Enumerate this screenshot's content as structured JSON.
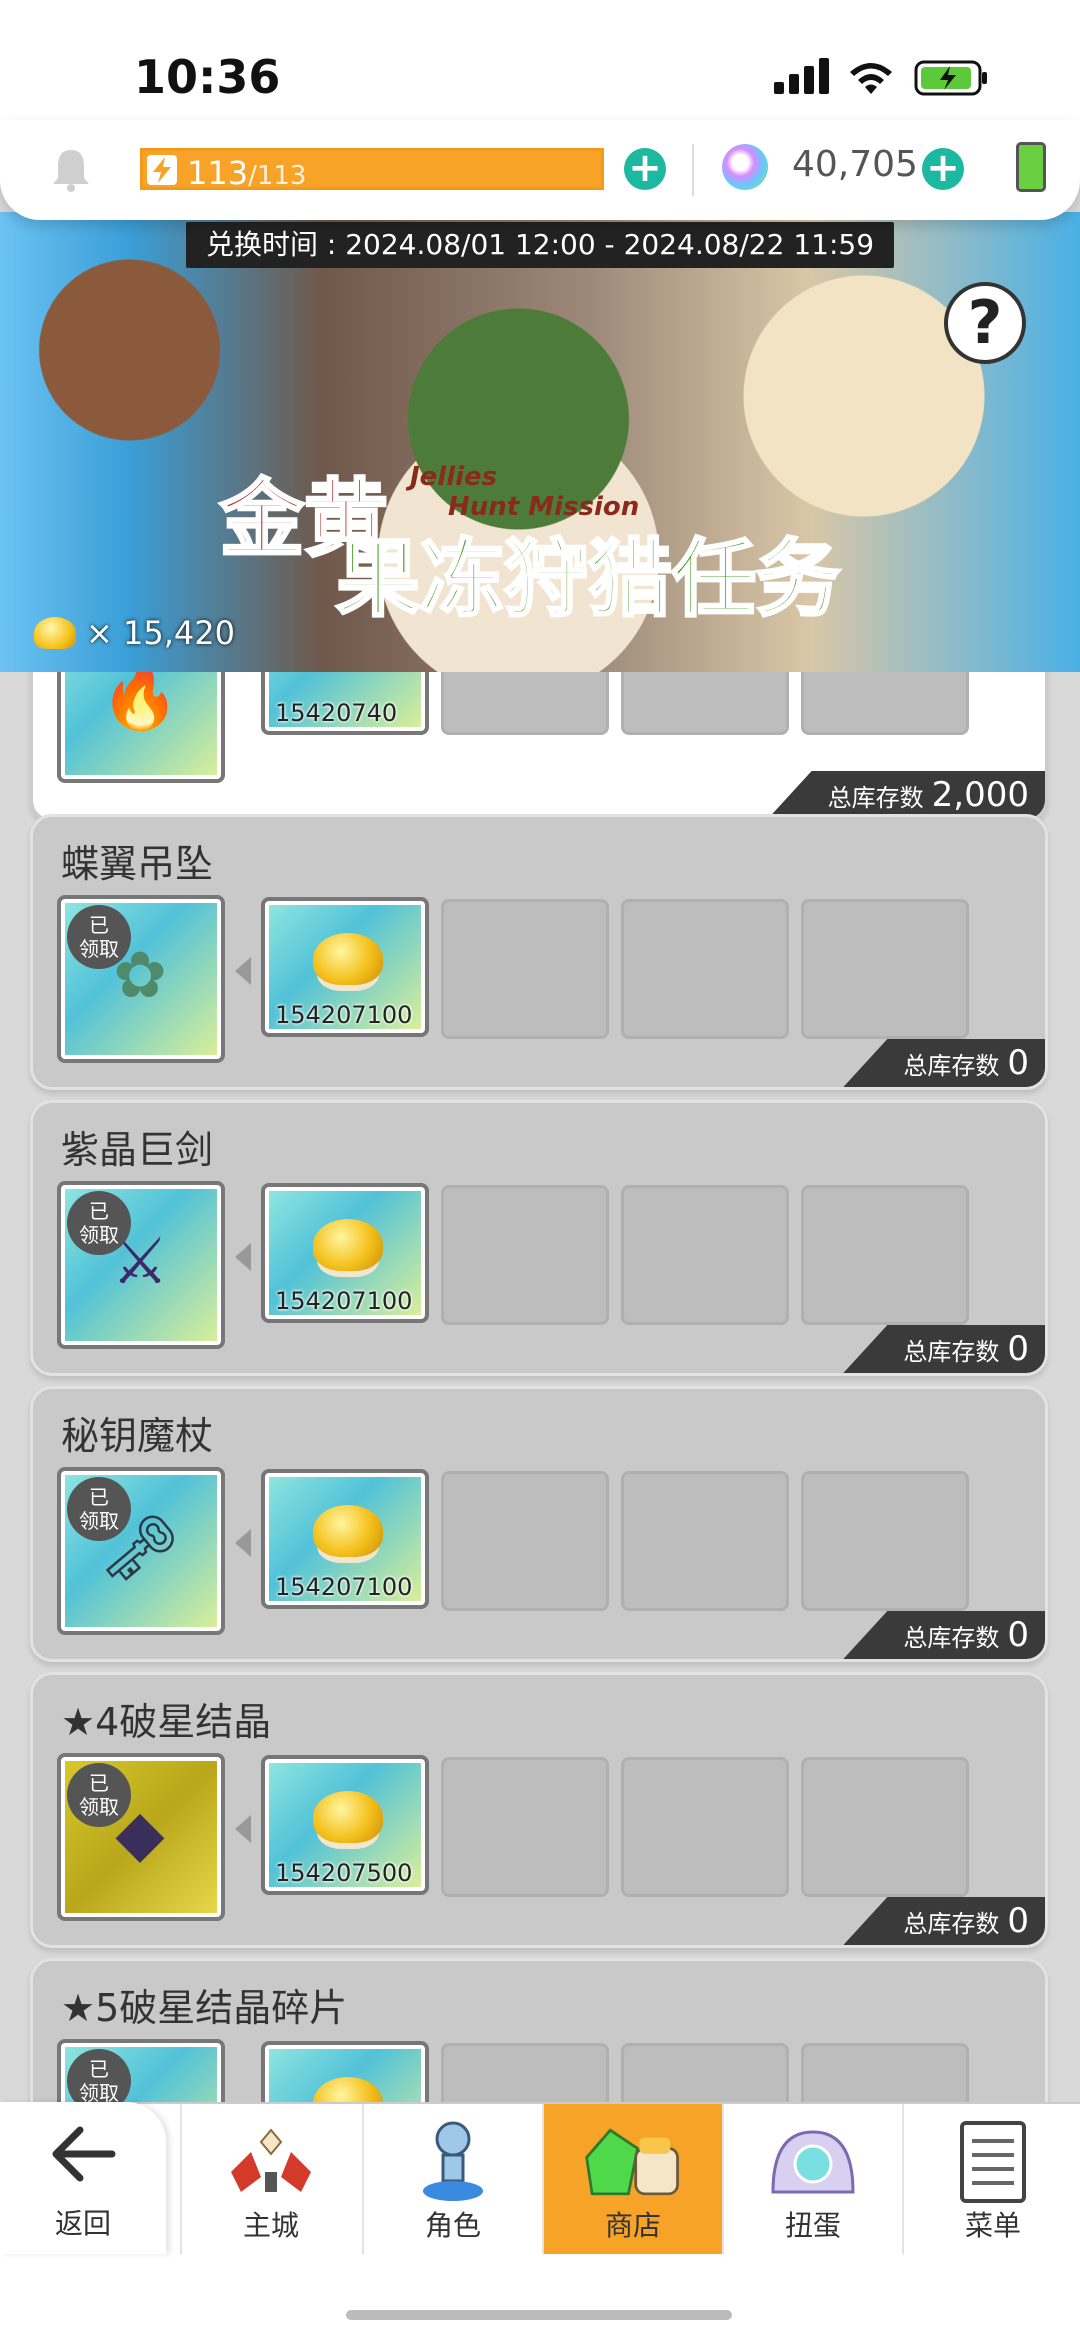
{
  "status_bar": {
    "time": "10:36"
  },
  "resources": {
    "energy_current": "113",
    "energy_max": "/113",
    "gems": "40,705"
  },
  "banner": {
    "exchange_time": "兑换时间 : 2024.08/01 12:00 - 2024.08/22 11:59",
    "title_cn_line1": "金黄",
    "title_cn_line2": "果冻狩猎任务",
    "title_en_line1": "Jellies",
    "title_en_line2": "Hunt Mission",
    "coin_count": "× 15,420",
    "help_label": "?"
  },
  "items": [
    {
      "name": "",
      "cost": "15420740",
      "stock_label": "总库存数",
      "stock": "2,000",
      "claimed": false
    },
    {
      "name": "蝶翼吊坠",
      "cost": "154207100",
      "stock_label": "总库存数",
      "stock": "0",
      "claimed": true
    },
    {
      "name": "紫晶巨剑",
      "cost": "154207100",
      "stock_label": "总库存数",
      "stock": "0",
      "claimed": true
    },
    {
      "name": "秘钥魔杖",
      "cost": "154207100",
      "stock_label": "总库存数",
      "stock": "0",
      "claimed": true
    },
    {
      "name": "★4破星结晶",
      "cost": "154207500",
      "stock_label": "总库存数",
      "stock": "0",
      "claimed": true
    },
    {
      "name": "★5破星结晶碎片",
      "cost": "",
      "stock_label": "",
      "stock": "",
      "claimed": true
    }
  ],
  "claimed_label_1": "已",
  "claimed_label_2": "领取",
  "nav": {
    "back": "返回",
    "main_city": "主城",
    "character": "角色",
    "shop": "商店",
    "gacha": "扭蛋",
    "menu": "菜单"
  },
  "colors": {
    "accent": "#f7a327",
    "teal": "#1db8a0"
  }
}
